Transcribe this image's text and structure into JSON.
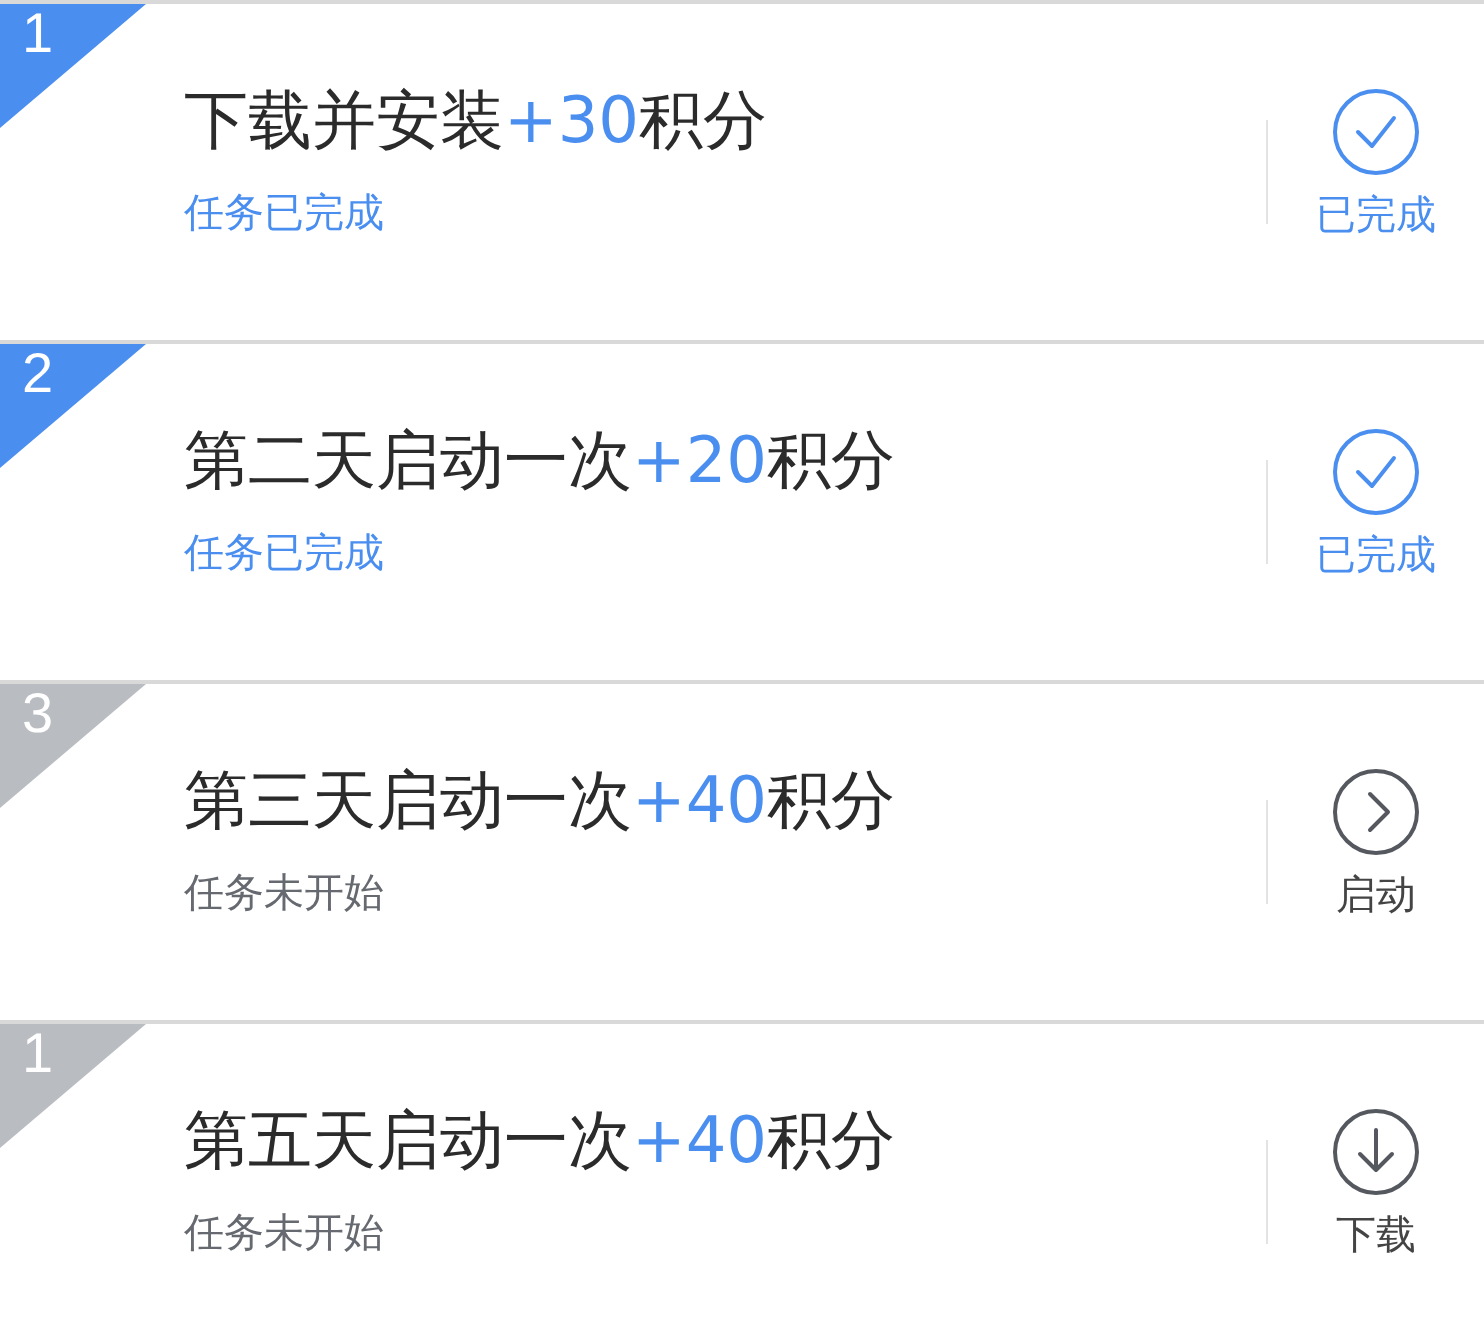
{
  "tasks": [
    {
      "number": "1",
      "kind": "done",
      "task": "下载并安装",
      "points": "+30",
      "unit": "积分",
      "status_text": "任务已完成",
      "action": {
        "kind": "done",
        "label": "已完成"
      }
    },
    {
      "number": "2",
      "kind": "done",
      "task": "第二天启动一次",
      "points": "+20",
      "unit": "积分",
      "status_text": "任务已完成",
      "action": {
        "kind": "done",
        "label": "已完成"
      }
    },
    {
      "number": "3",
      "kind": "pending",
      "task": "第三天启动一次",
      "points": "+40",
      "unit": "积分",
      "status_text": "任务未开始",
      "action": {
        "kind": "launch",
        "label": "启动"
      }
    },
    {
      "number": "1",
      "kind": "pending",
      "task": "第五天启动一次",
      "points": "+40",
      "unit": "积分",
      "status_text": "任务未开始",
      "action": {
        "kind": "download",
        "label": "下载"
      }
    }
  ]
}
